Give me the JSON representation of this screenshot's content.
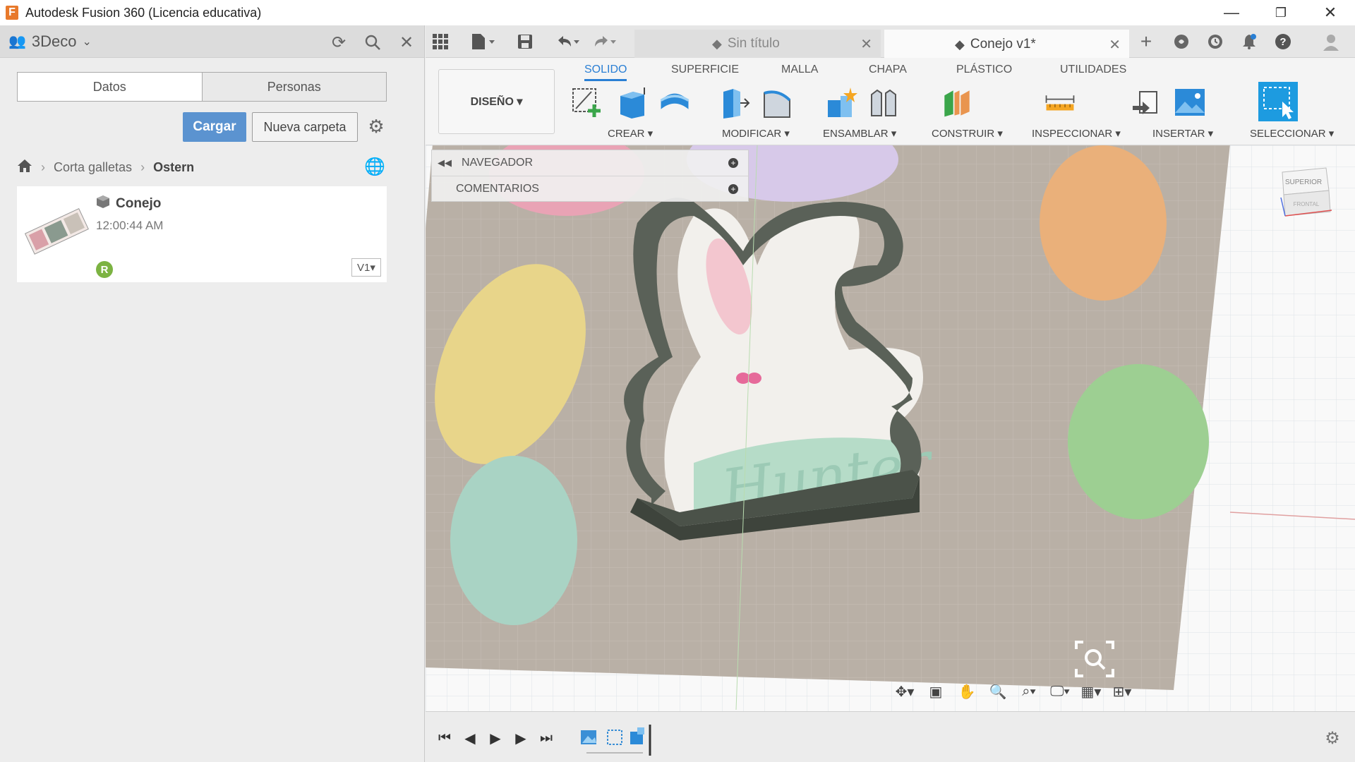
{
  "window": {
    "title": "Autodesk Fusion 360 (Licencia educativa)",
    "app_icon_letter": "F",
    "controls": [
      "—",
      "❐",
      "✕"
    ]
  },
  "data_panel": {
    "team": "3Deco",
    "tabs": [
      "Datos",
      "Personas"
    ],
    "upload_label": "Cargar",
    "new_folder_label": "Nueva carpeta",
    "breadcrumb": [
      "Corta galletas",
      "Ostern"
    ],
    "file": {
      "name": "Conejo",
      "time": "12:00:44 AM",
      "badge": "R",
      "version": "V1▾"
    }
  },
  "doc_tabs": [
    {
      "label": "Sin título"
    },
    {
      "label": "Conejo v1*"
    }
  ],
  "toolbar": {
    "workspace": "DISEÑO ▾",
    "tabs": [
      "SOLIDO",
      "SUPERFICIE",
      "MALLA",
      "CHAPA",
      "PLÁSTICO",
      "UTILIDADES"
    ],
    "active_tab": "SOLIDO",
    "groups": [
      "CREAR ▾",
      "MODIFICAR ▾",
      "ENSAMBLAR ▾",
      "CONSTRUIR ▾",
      "INSPECCIONAR ▾",
      "INSERTAR ▾",
      "SELECCIONAR ▾"
    ]
  },
  "browser": {
    "rows": [
      "NAVEGADOR",
      "COMENTARIOS"
    ]
  },
  "viewcube": {
    "top": "SUPERIOR",
    "front": "FRONTAL"
  },
  "model": {
    "text": "Hunter"
  },
  "colors": {
    "accent": "#2a7fd4",
    "upload_button": "#5b93d0",
    "cutter": "#5a6158",
    "badge": "#7cb342"
  }
}
